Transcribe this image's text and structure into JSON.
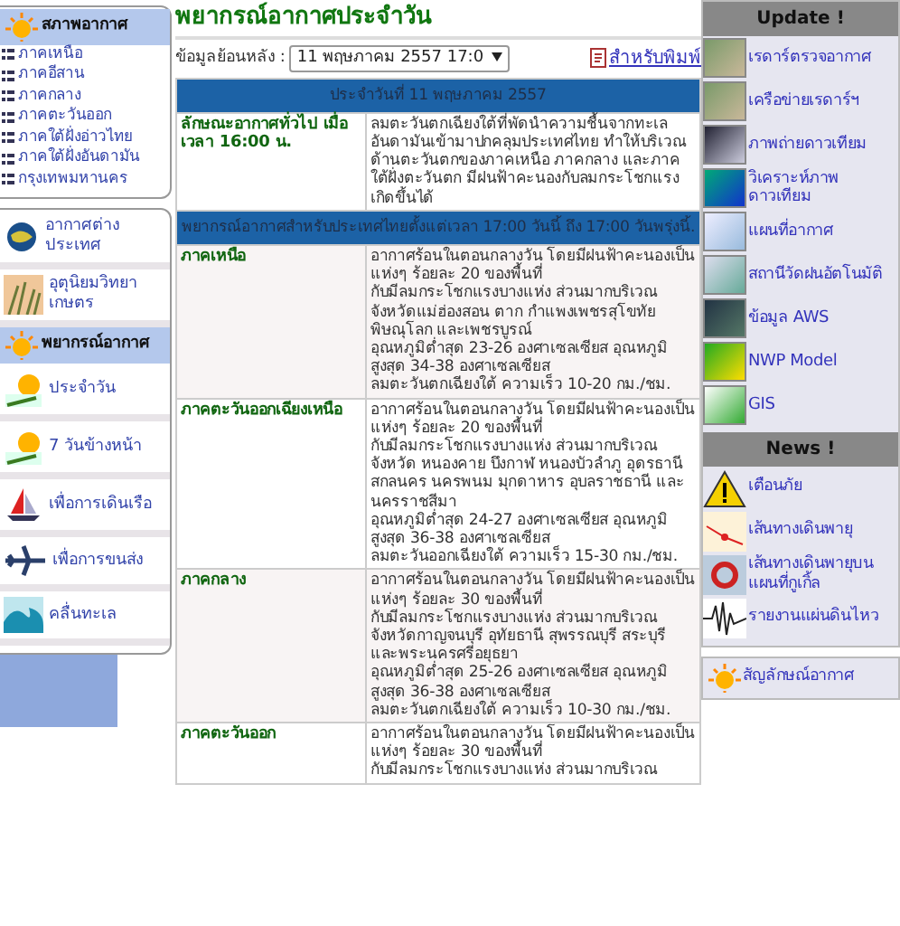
{
  "left_menu": {
    "weather_header": "สภาพอากาศ",
    "weather_links": [
      "ภาคเหนือ",
      "ภาคอีสาน",
      "ภาคกลาง",
      "ภาคตะวันออก",
      "ภาคใต้ฝั่งอ่าวไทย",
      "ภาคใต้ฝั่งอันดามัน",
      "กรุงเทพมหานคร"
    ],
    "top_items": [
      "อากาศต่างประเทศ",
      "อุตุนิยมวิทยาเกษตร"
    ],
    "forecast_header": "พยากรณ์อากาศ",
    "forecast_items": [
      "ประจำวัน",
      "7 วันข้างหน้า",
      "เพื่อการเดินเรือ",
      "เพื่อการขนส่ง",
      "คลื่นทะเล"
    ]
  },
  "main": {
    "title": "พยากรณ์อากาศประจำวัน",
    "history_label": "ข้อมูลย้อนหลัง :",
    "history_value": "11 พฤษภาคม 2557 17:0",
    "print_link": "สำหรับพิมพ์",
    "date_header": "ประจำวันที่ 11 พฤษภาคม 2557",
    "general": {
      "label": "ลักษณะอากาศทั่วไป เมื่อเวลา 16:00 น.",
      "text": "ลมตะวันตกเฉียงใต้ที่พัดนำความชื้นจากทะเลอันดามันเข้ามาปกคลุมประเทศไทย ทำให้บริเวณด้านตะวันตกของภาคเหนือ ภาคกลาง และภาคใต้ฝั่งตะวันตก มีฝนฟ้าคะนองกับลมกระโชกแรงเกิดขึ้นได้"
    },
    "forecast_header": "พยากรณ์อากาศสำหรับประเทศไทยตั้งแต่เวลา 17:00 วันนี้ ถึง 17:00 วันพรุ่งนี้.",
    "regions": [
      {
        "name": "ภาคเหนือ",
        "lines": [
          "อากาศร้อนในตอนกลางวัน โดยมีฝนฟ้าคะนองเป็นแห่งๆ ร้อยละ 20 ของพื้นที่",
          "กับมีลมกระโชกแรงบางแห่ง ส่วนมากบริเวณจังหวัดแม่ฮ่องสอน ตาก กำแพงเพชรสุโขทัย พิษณุโลก และเพชรบูรณ์",
          "อุณหภูมิต่ำสุด 23-26 องศาเซลเซียส อุณหภูมิสูงสุด 34-38 องศาเซลเซียส",
          "ลมตะวันตกเฉียงใต้ ความเร็ว 10-20 กม./ชม."
        ]
      },
      {
        "name": "ภาคตะวันออกเฉียงเหนือ",
        "lines": [
          "อากาศร้อนในตอนกลางวัน โดยมีฝนฟ้าคะนองเป็นแห่งๆ ร้อยละ 20 ของพื้นที่",
          "กับมีลมกระโชกแรงบางแห่ง ส่วนมากบริเวณจังหวัด หนองคาย บึงกาฬ หนองบัวลำภู อุดรธานี สกลนคร นครพนม มุกดาหาร อุบลราชธานี และนครราชสีมา",
          "อุณหภูมิต่ำสุด 24-27 องศาเซลเซียส อุณหภูมิสูงสุด 36-38 องศาเซลเซียส",
          "ลมตะวันออกเฉียงใต้ ความเร็ว 15-30 กม./ชม."
        ]
      },
      {
        "name": "ภาคกลาง",
        "lines": [
          "อากาศร้อนในตอนกลางวัน โดยมีฝนฟ้าคะนองเป็นแห่งๆ ร้อยละ 30 ของพื้นที่",
          "กับมีลมกระโชกแรงบางแห่ง ส่วนมากบริเวณจังหวัดกาญจนบุรี อุทัยธานี สุพรรณบุรี สระบุรี และพระนครศรีอยุธยา",
          "อุณหภูมิต่ำสุด 25-26 องศาเซลเซียส อุณหภูมิสูงสุด 36-38 องศาเซลเซียส",
          "ลมตะวันตกเฉียงใต้ ความเร็ว 10-30 กม./ชม."
        ]
      },
      {
        "name": "ภาคตะวันออก",
        "lines": [
          "อากาศร้อนในตอนกลางวัน โดยมีฝนฟ้าคะนองเป็นแห่งๆ ร้อยละ 30 ของพื้นที่",
          "กับมีลมกระโชกแรงบางแห่ง ส่วนมากบริเวณ"
        ]
      }
    ]
  },
  "right_menu": {
    "update_header": "Update !",
    "update_items": [
      "เรดาร์ตรวจอากาศ",
      "เครือข่ายเรดาร์ฯ",
      "ภาพถ่ายดาวเทียม",
      "วิเคราะห์ภาพดาวเทียม",
      "แผนที่อากาศ",
      "สถานีวัดฝนอัตโนมัติ",
      "ข้อมูล AWS",
      "NWP Model",
      "GIS"
    ],
    "news_header": "News !",
    "news_items": [
      "เตือนภัย",
      "เส้นทางเดินพายุ",
      "เส้นทางเดินพายุบนแผนที่กูเกิ้ล",
      "รายงานแผ่นดินไหว"
    ],
    "symbols_link": "สัญลักษณ์อากาศ"
  }
}
